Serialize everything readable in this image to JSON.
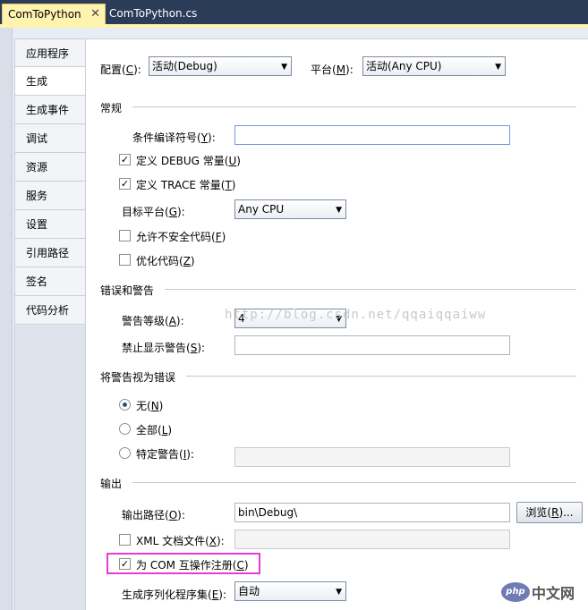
{
  "tabs": [
    {
      "label": "ComToPython"
    },
    {
      "label": "ComToPython.cs"
    }
  ],
  "nav": {
    "items": [
      "应用程序",
      "生成",
      "生成事件",
      "调试",
      "资源",
      "服务",
      "设置",
      "引用路径",
      "签名",
      "代码分析"
    ],
    "active_index": 1
  },
  "config": {
    "label": "配置(",
    "hotkey": "C",
    "suffix": "):",
    "value": "活动(Debug)"
  },
  "platform": {
    "label": "平台(",
    "hotkey": "M",
    "suffix": "):",
    "value": "活动(Any CPU)"
  },
  "general": {
    "title": "常规",
    "conditional_symbols": {
      "label": "条件编译符号(",
      "hotkey": "Y",
      "suffix": "):",
      "value": ""
    },
    "define_debug": {
      "label": "定义 DEBUG 常量(",
      "hotkey": "U",
      "suffix": ")",
      "checked": true
    },
    "define_trace": {
      "label": "定义 TRACE 常量(",
      "hotkey": "T",
      "suffix": ")",
      "checked": true
    },
    "target_platform": {
      "label": "目标平台(",
      "hotkey": "G",
      "suffix": "):",
      "value": "Any CPU"
    },
    "allow_unsafe": {
      "label": "允许不安全代码(",
      "hotkey": "F",
      "suffix": ")",
      "checked": false
    },
    "optimize": {
      "label": "优化代码(",
      "hotkey": "Z",
      "suffix": ")",
      "checked": false
    }
  },
  "errors": {
    "title": "错误和警告",
    "warning_level": {
      "label": "警告等级(",
      "hotkey": "A",
      "suffix": "):",
      "value": "4"
    },
    "suppress": {
      "label": "禁止显示警告(",
      "hotkey": "S",
      "suffix": "):",
      "value": ""
    }
  },
  "treat_warnings": {
    "title": "将警告视为错误",
    "none": {
      "label": "无(",
      "hotkey": "N",
      "suffix": ")",
      "selected": true
    },
    "all": {
      "label": "全部(",
      "hotkey": "L",
      "suffix": ")",
      "selected": false
    },
    "specific": {
      "label": "特定警告(",
      "hotkey": "I",
      "suffix": "):",
      "selected": false,
      "value": ""
    }
  },
  "output": {
    "title": "输出",
    "path": {
      "label": "输出路径(",
      "hotkey": "O",
      "suffix": "):",
      "value": "bin\\Debug\\"
    },
    "browse": {
      "label": "浏览(",
      "hotkey": "R",
      "suffix": ")..."
    },
    "xml_doc": {
      "label": "XML 文档文件(",
      "hotkey": "X",
      "suffix": "):",
      "checked": false,
      "value": ""
    },
    "com_interop": {
      "label": "为 COM 互操作注册(",
      "hotkey": "C",
      "suffix": ")",
      "checked": true
    },
    "serialization": {
      "label": "生成序列化程序集(",
      "hotkey": "E",
      "suffix": "):",
      "value": "自动"
    }
  },
  "watermark": "http://blog.csdn.net/qqaiqqaiww",
  "brand": {
    "php": "php",
    "cn": "中文网"
  },
  "colors": {
    "highlight": "#e83ad8",
    "tab_active": "#fff3b0",
    "chrome": "#2b3c59"
  }
}
